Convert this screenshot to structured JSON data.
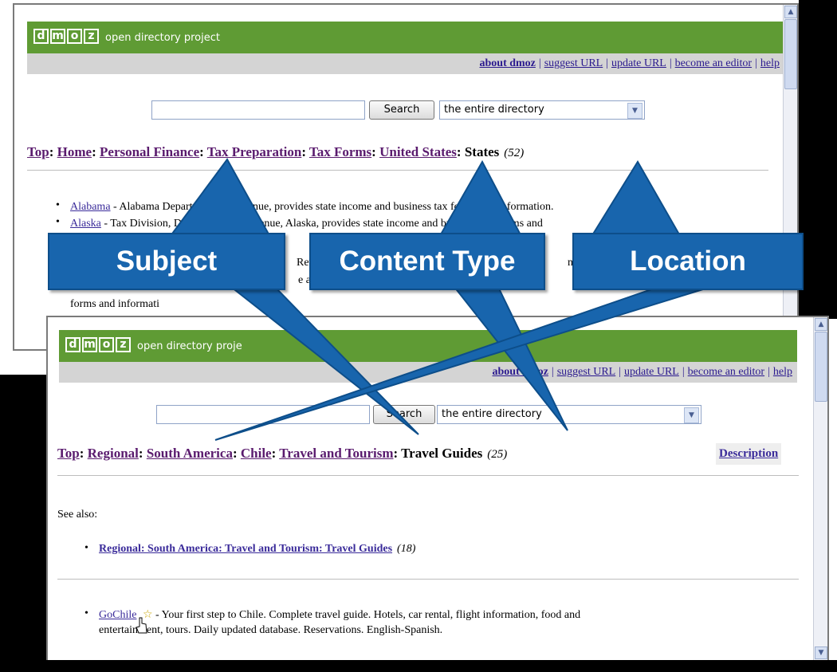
{
  "top_window": {
    "logo_letters": [
      "d",
      "m",
      "o",
      "z"
    ],
    "tagline": "open directory project",
    "nav": [
      "about dmoz",
      "suggest URL",
      "update URL",
      "become an editor",
      "help"
    ],
    "search_button": "Search",
    "scope_select": "the entire directory",
    "breadcrumb": [
      "Top",
      "Home",
      "Personal Finance",
      "Tax Preparation",
      "Tax Forms",
      "United States"
    ],
    "breadcrumb_current": "States",
    "count": "(52)",
    "entries": [
      {
        "link": "Alabama",
        "desc": " - Alabama Department of Revenue, provides state income and business tax forms and information."
      },
      {
        "link": "Alaska",
        "desc": " - Tax Division, Department of Revenue, Alaska, provides state income and business tax forms and"
      },
      {
        "link": "",
        "desc": "Rev"
      },
      {
        "link": "",
        "desc": "ness t"
      },
      {
        "link": "",
        "desc": "e an"
      },
      {
        "link": "",
        "desc": "state"
      },
      {
        "link": "",
        "desc": "forms and informati"
      }
    ]
  },
  "bottom_window": {
    "logo_letters": [
      "d",
      "m",
      "o",
      "z"
    ],
    "tagline": "open directory proje",
    "nav": [
      "about dmoz",
      "suggest URL",
      "update URL",
      "become an editor",
      "help"
    ],
    "search_button": "Search",
    "scope_select": "the entire directory",
    "breadcrumb": [
      "Top",
      "Regional",
      "South America",
      "Chile",
      "Travel and Tourism"
    ],
    "breadcrumb_current": "Travel Guides",
    "count": "(25)",
    "description_link": "Description",
    "see_also_label": "See also:",
    "see_also_link": "Regional: South America: Travel and Tourism: Travel Guides",
    "see_also_count": "(18)",
    "site": {
      "link": "GoChile",
      "desc_line1": " - Your first step to Chile. Complete travel guide. Hotels, car rental, flight information, food and",
      "desc_line2": "entertainment, tours. Daily updated database. Reservations. English-Spanish."
    }
  },
  "callouts": {
    "subject": "Subject",
    "content_type": "Content Type",
    "location": "Location"
  },
  "colors": {
    "dmoz_green": "#5f9b34",
    "callout_blue": "#1865ad",
    "link_purple": "#5a1b6e",
    "link_blue": "#3a2b9a"
  }
}
